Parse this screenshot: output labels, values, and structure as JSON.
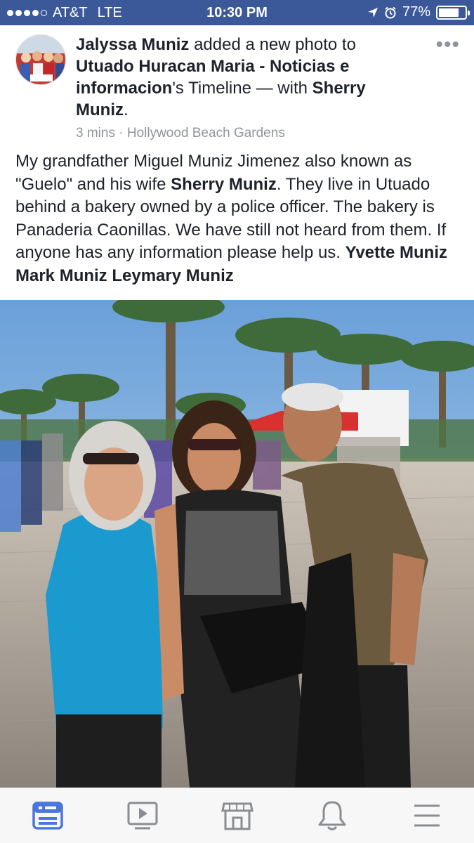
{
  "status_bar": {
    "carrier": "AT&T",
    "network": "LTE",
    "time": "10:30 PM",
    "battery_percent": "77%",
    "battery_level": 0.77,
    "signal_bars_filled": 4,
    "signal_bars_total": 5
  },
  "post": {
    "author": "Jalyssa Muniz",
    "action_text": " added a new photo to ",
    "target_page": "Utuado Huracan Maria - Noticias e informacion",
    "target_suffix": "'s Timeline — with ",
    "tagged": "Sherry Muniz",
    "tagged_suffix": ".",
    "time_ago": "3 mins",
    "separator": " · ",
    "location": "Hollywood Beach Gardens",
    "body": {
      "part1": "My grandfather Miguel Muniz Jimenez also known as \"Guelo\" and his wife ",
      "tag1": "Sherry Muniz",
      "part2": ". They live in Utuado behind a bakery owned by a police officer. The bakery is Panaderia Caonillas. We have still not heard from them. If anyone has any information please help us. ",
      "tag2": "Yvette Muniz",
      "space1": " ",
      "tag3": "Mark Muniz",
      "space2": " ",
      "tag4": "Leymary Muniz"
    },
    "more_glyph": "•••"
  },
  "tabs": [
    {
      "icon": "news-feed-icon",
      "active": true
    },
    {
      "icon": "video-icon",
      "active": false
    },
    {
      "icon": "marketplace-icon",
      "active": false
    },
    {
      "icon": "notifications-bell-icon",
      "active": false
    },
    {
      "icon": "menu-icon",
      "active": false
    }
  ],
  "colors": {
    "brand_blue": "#3b5998",
    "active_tab": "#4a76dd",
    "inactive_tab": "#8a8d91",
    "meta_gray": "#90949c"
  }
}
